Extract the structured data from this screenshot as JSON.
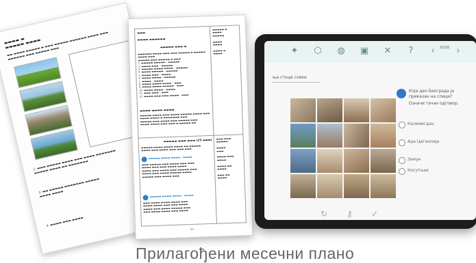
{
  "caption": "Прилагођени месечни плано",
  "tablet": {
    "question_header": "ња стоци слике",
    "question": "Који део Београда је приказан на слици?",
    "subtext": "Означи тачан одговор.",
    "options": [
      "Калемегдан",
      "Ада Циганлија",
      "Земун",
      "Косутњак"
    ],
    "page_indicator": "15/16"
  },
  "document": {
    "page_number": "97"
  },
  "colors": {
    "tablet_frame": "#1c1c1c",
    "toolbar": "#e9f3f1",
    "accent_blue": "#2f77c9",
    "caption": "#666666"
  }
}
